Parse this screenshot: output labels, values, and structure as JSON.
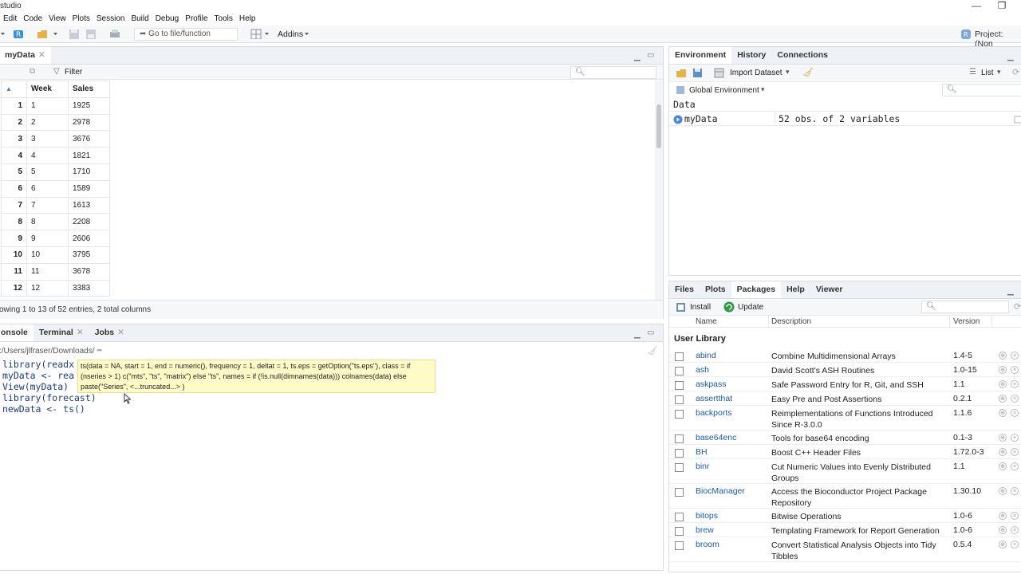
{
  "window": {
    "title": "studio",
    "minimize": "—",
    "restore": "❐"
  },
  "menu": [
    "Edit",
    "Code",
    "View",
    "Plots",
    "Session",
    "Build",
    "Debug",
    "Profile",
    "Tools",
    "Help"
  ],
  "toolbar": {
    "goto_label": "Go to file/function",
    "addins_label": "Addins",
    "project_label": "Project: (Non"
  },
  "source": {
    "tab_label": "myData",
    "filter_label": "Filter",
    "columns": [
      "Week",
      "Sales"
    ],
    "rows": [
      [
        "1",
        "1",
        "1925"
      ],
      [
        "2",
        "2",
        "2978"
      ],
      [
        "3",
        "3",
        "3676"
      ],
      [
        "4",
        "4",
        "1821"
      ],
      [
        "5",
        "5",
        "1710"
      ],
      [
        "6",
        "6",
        "1589"
      ],
      [
        "7",
        "7",
        "1613"
      ],
      [
        "8",
        "8",
        "2208"
      ],
      [
        "9",
        "9",
        "2606"
      ],
      [
        "10",
        "10",
        "3795"
      ],
      [
        "11",
        "11",
        "3678"
      ],
      [
        "12",
        "12",
        "3383"
      ]
    ],
    "status": "owing 1 to 13 of 52 entries, 2 total columns"
  },
  "console": {
    "tabs": [
      "onsole",
      "Terminal",
      "Jobs"
    ],
    "path": ":/Users/jlfraser/Downloads/",
    "lines": [
      "library(readx",
      "myData <- rea",
      "View(myData)",
      "library(forecast)",
      "newData <- ts()"
    ],
    "tooltip": "ts(data = NA, start = 1, end = numeric(), frequency = 1, deltat = 1, ts.eps = getOption(\"ts.eps\"), class = if (nseries > 1) c(\"mts\", \"ts\", \"matrix\") else \"ts\", names = if (!is.null(dimnames(data))) colnames(data) else paste(\"Series\", <...truncated...> )"
  },
  "environment": {
    "tabs": [
      "Environment",
      "History",
      "Connections"
    ],
    "import_label": "Import Dataset",
    "list_label": "List",
    "scope_label": "Global Environment",
    "section": "Data",
    "item_name": "myData",
    "item_value": "52 obs. of 2 variables"
  },
  "packages": {
    "tabs": [
      "Files",
      "Plots",
      "Packages",
      "Help",
      "Viewer"
    ],
    "install_label": "Install",
    "update_label": "Update",
    "headers": [
      "Name",
      "Description",
      "Version"
    ],
    "section": "User Library",
    "rows": [
      {
        "name": "abind",
        "desc": "Combine Multidimensional Arrays",
        "ver": "1.4-5"
      },
      {
        "name": "ash",
        "desc": "David Scott's ASH Routines",
        "ver": "1.0-15"
      },
      {
        "name": "askpass",
        "desc": "Safe Password Entry for R, Git, and SSH",
        "ver": "1.1"
      },
      {
        "name": "assertthat",
        "desc": "Easy Pre and Post Assertions",
        "ver": "0.2.1"
      },
      {
        "name": "backports",
        "desc": "Reimplementations of Functions Introduced Since R-3.0.0",
        "ver": "1.1.6"
      },
      {
        "name": "base64enc",
        "desc": "Tools for base64 encoding",
        "ver": "0.1-3"
      },
      {
        "name": "BH",
        "desc": "Boost C++ Header Files",
        "ver": "1.72.0-3"
      },
      {
        "name": "binr",
        "desc": "Cut Numeric Values into Evenly Distributed Groups",
        "ver": "1.1"
      },
      {
        "name": "BiocManager",
        "desc": "Access the Bioconductor Project Package Repository",
        "ver": "1.30.10"
      },
      {
        "name": "bitops",
        "desc": "Bitwise Operations",
        "ver": "1.0-6"
      },
      {
        "name": "brew",
        "desc": "Templating Framework for Report Generation",
        "ver": "1.0-6"
      },
      {
        "name": "broom",
        "desc": "Convert Statistical Analysis Objects into Tidy Tibbles",
        "ver": "0.5.4"
      }
    ]
  }
}
